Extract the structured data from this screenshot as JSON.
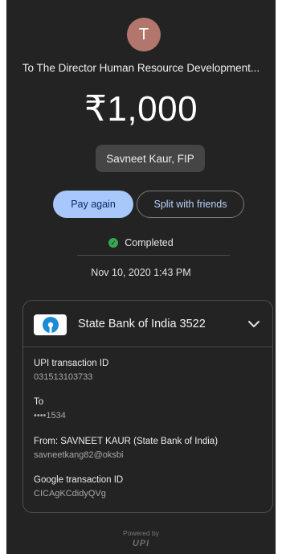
{
  "header": {
    "avatar_initial": "T",
    "payee": "To The Director Human Resource Development...",
    "amount": "₹1,000",
    "note": "Savneet Kaur, FIP"
  },
  "actions": {
    "pay_again": "Pay again",
    "split": "Split with friends"
  },
  "status": {
    "text": "Completed",
    "color": "#36a852",
    "datetime": "Nov 10, 2020 1:43 PM"
  },
  "card": {
    "bank_name": "State Bank of India 3522",
    "bank_logo_icon": "sbi-logo-icon",
    "details": [
      {
        "label": "UPI transaction ID",
        "value": "031513103733"
      },
      {
        "label": "To",
        "value": "••••1534"
      },
      {
        "label": "From: SAVNEET  KAUR (State Bank of India)",
        "value": "savneetkang82@oksbi"
      },
      {
        "label": "Google transaction ID",
        "value": "CICAgKCdidyQVg"
      }
    ]
  },
  "footer": {
    "powered_by": "Powered by",
    "brand": "UPI"
  },
  "colors": {
    "background": "#232323",
    "accent": "#a8c7fa",
    "avatar": "#b3766d"
  }
}
